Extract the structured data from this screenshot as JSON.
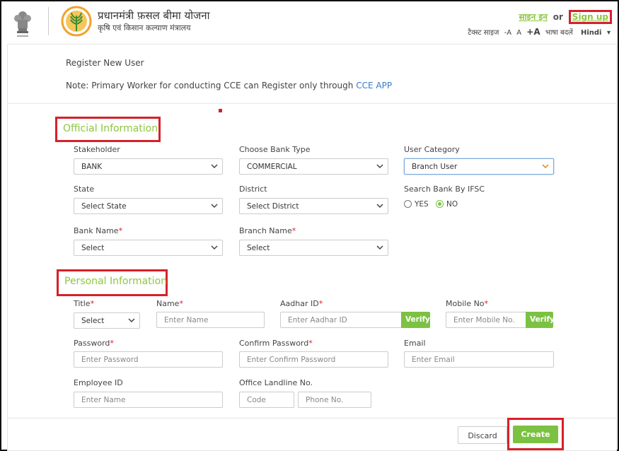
{
  "header": {
    "title_hindi": "प्रधानमंत्री फ़सल बीमा योजना",
    "subtitle_hindi": "कृषि एवं किसान कल्याण मंत्रालय",
    "signin_label": "साइन इन",
    "or_label": "or",
    "signup_label": "Sign up",
    "text_size_label": "टैक्स्ट साइज",
    "font_small": "-A",
    "font_normal": "A",
    "font_large": "+A",
    "language_label": "भाषा बदलें",
    "language_value": "Hindi"
  },
  "page": {
    "register_title": "Register New User",
    "note_prefix": "Note: Primary Worker for conducting CCE can Register only through",
    "note_link": "CCE APP"
  },
  "official": {
    "section_title": "Official Information",
    "stakeholder_label": "Stakeholder",
    "stakeholder_value": "BANK",
    "bank_type_label": "Choose Bank Type",
    "bank_type_value": "COMMERCIAL",
    "user_category_label": "User Category",
    "user_category_value": "Branch User",
    "state_label": "State",
    "state_value": "Select State",
    "district_label": "District",
    "district_value": "Select District",
    "ifsc_label": "Search Bank By IFSC",
    "ifsc_yes": "YES",
    "ifsc_no": "NO",
    "bank_name_label": "Bank Name",
    "bank_name_value": "Select",
    "branch_name_label": "Branch Name",
    "branch_name_value": "Select"
  },
  "personal": {
    "section_title": "Personal Information",
    "title_label": "Title",
    "title_value": "Select",
    "name_label": "Name",
    "name_placeholder": "Enter Name",
    "aadhar_label": "Aadhar ID",
    "aadhar_placeholder": "Enter Aadhar ID",
    "aadhar_verify": "Verify",
    "mobile_label": "Mobile No",
    "mobile_placeholder": "Enter Mobile No.",
    "mobile_verify": "Verify",
    "password_label": "Password",
    "password_placeholder": "Enter Password",
    "confirm_label": "Confirm Password",
    "confirm_placeholder": "Enter Confirm Password",
    "email_label": "Email",
    "email_placeholder": "Enter Email",
    "employee_label": "Employee ID",
    "employee_placeholder": "Enter Name",
    "landline_label": "Office Landline No.",
    "code_placeholder": "Code",
    "phone_placeholder": "Phone No."
  },
  "actions": {
    "discard_label": "Discard",
    "create_label": "Create"
  },
  "required_mark": "*",
  "colors": {
    "accent_green": "#7cc242",
    "highlight_red": "#d6202a",
    "link_blue": "#3a7bc8"
  }
}
